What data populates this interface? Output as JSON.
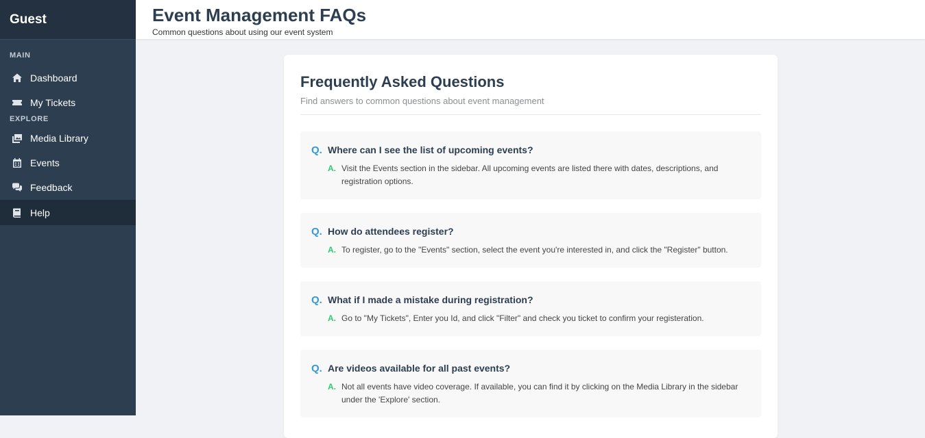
{
  "sidebar": {
    "user_name": "Guest",
    "sections": {
      "main_label": "MAIN",
      "explore_label": "EXPLORE"
    },
    "main_items": [
      {
        "label": "Dashboard",
        "icon": "home-icon"
      },
      {
        "label": "My Tickets",
        "icon": "ticket-icon"
      }
    ],
    "explore_items": [
      {
        "label": "Media Library",
        "icon": "images-icon"
      },
      {
        "label": "Events",
        "icon": "calendar-icon"
      },
      {
        "label": "Feedback",
        "icon": "comments-icon"
      },
      {
        "label": "Help",
        "icon": "book-icon",
        "active": true
      }
    ]
  },
  "header": {
    "title": "Event Management FAQs",
    "subtitle": "Common questions about using our event system"
  },
  "faq": {
    "title": "Frequently Asked Questions",
    "subtitle": "Find answers to common questions about event management",
    "q_marker": "Q.",
    "a_marker": "A.",
    "items": [
      {
        "question": "Where can I see the list of upcoming events?",
        "answer": "Visit the Events section in the sidebar. All upcoming events are listed there with dates, descriptions, and registration options."
      },
      {
        "question": "How do attendees register?",
        "answer": "To register, go to the \"Events\" section, select the event you're interested in, and click the \"Register\" button."
      },
      {
        "question": "What if I made a mistake during registration?",
        "answer": "Go to \"My Tickets\", Enter you Id, and click \"Filter\" and check you ticket to confirm your registeration."
      },
      {
        "question": "Are videos available for all past events?",
        "answer": "Not all events have video coverage. If available, you can find it by clicking on the Media Library in the sidebar under the 'Explore' section."
      }
    ]
  },
  "colors": {
    "sidebar_bg": "#2c3e50",
    "question_marker": "#3498db",
    "answer_marker": "#2ecc71",
    "title_text": "#2c3e50"
  }
}
